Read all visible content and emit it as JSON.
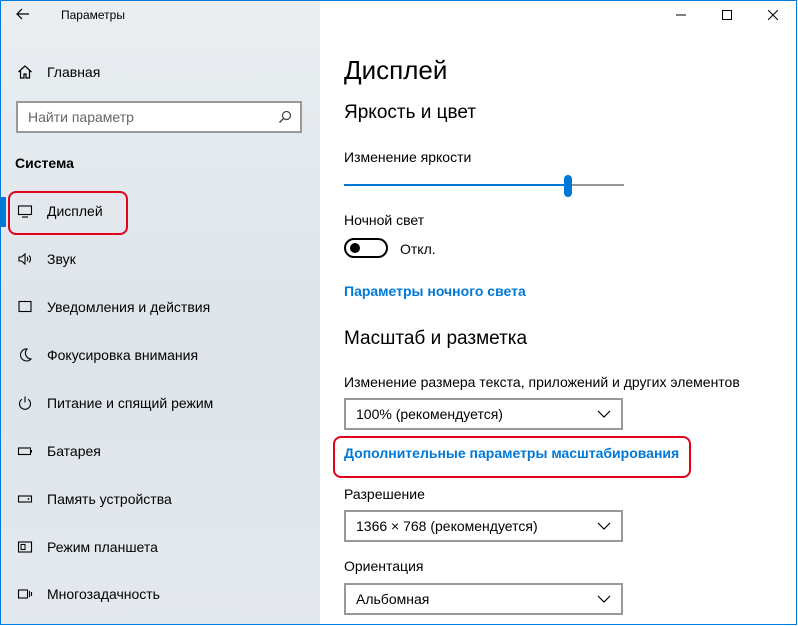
{
  "window": {
    "title": "Параметры",
    "back_icon": "back-arrow-icon",
    "controls": [
      "minimize-icon",
      "maximize-icon",
      "close-icon"
    ]
  },
  "sidebar": {
    "home": {
      "label": "Главная",
      "icon": "home-icon"
    },
    "search": {
      "placeholder": "Найти параметр",
      "icon": "search-icon"
    },
    "section": "Система",
    "items": [
      {
        "label": "Дисплей",
        "icon": "display-icon",
        "active": true
      },
      {
        "label": "Звук",
        "icon": "speaker-icon"
      },
      {
        "label": "Уведомления и действия",
        "icon": "notifications-icon"
      },
      {
        "label": "Фокусировка внимания",
        "icon": "moon-icon"
      },
      {
        "label": "Питание и спящий режим",
        "icon": "power-icon"
      },
      {
        "label": "Батарея",
        "icon": "battery-icon"
      },
      {
        "label": "Память устройства",
        "icon": "storage-icon"
      },
      {
        "label": "Режим планшета",
        "icon": "tablet-icon"
      },
      {
        "label": "Многозадачность",
        "icon": "multitasking-icon"
      }
    ]
  },
  "main": {
    "title": "Дисплей",
    "brightness_section": "Яркость и цвет",
    "brightness_label": "Изменение яркости",
    "brightness_value": 0.8,
    "night_light_label": "Ночной свет",
    "night_light_state": "Откл.",
    "night_light_link": "Параметры ночного света",
    "scale_section": "Масштаб и разметка",
    "scale_label": "Изменение размера текста, приложений и других элементов",
    "scale_value": "100% (рекомендуется)",
    "advanced_scale_link": "Дополнительные параметры масштабирования",
    "resolution_label": "Разрешение",
    "resolution_value": "1366 × 768 (рекомендуется)",
    "orientation_label": "Ориентация",
    "orientation_value": "Альбомная"
  },
  "colors": {
    "accent": "#0078d7",
    "highlight_box": "#e3001b"
  }
}
